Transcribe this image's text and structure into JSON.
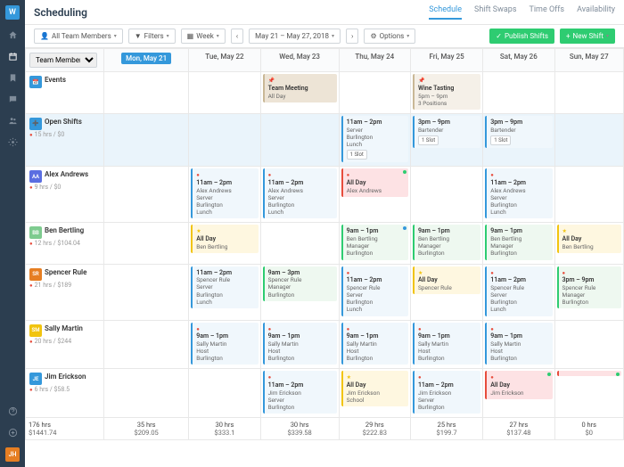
{
  "app": {
    "logo": "W",
    "avatar": "JH"
  },
  "header": {
    "title": "Scheduling",
    "tabs": [
      "Schedule",
      "Shift Swaps",
      "Time Offs",
      "Availability"
    ],
    "active": 0
  },
  "toolbar": {
    "team": "All Team Members",
    "filters": "Filters",
    "view": "Week",
    "range": "May 21 – May 27, 2018",
    "options": "Options",
    "publish": "Publish Shifts",
    "new": "New Shift",
    "members_label": "Team Members"
  },
  "days": [
    "Mon, May 21",
    "Tue, May 22",
    "Wed, May 23",
    "Thu, May 24",
    "Fri, May 25",
    "Sat, May 26",
    "Sun, May 27"
  ],
  "rows": {
    "events": {
      "label": "Events",
      "icon": "📅",
      "cells": [
        [],
        [],
        [
          {
            "cls": "beige pin",
            "t": "Team Meeting",
            "d": [
              "All Day"
            ]
          }
        ],
        [],
        [
          {
            "cls": "bage pin",
            "t": "Wine Tasting",
            "d": [
              "5pm – 9pm",
              "3 Positions"
            ]
          }
        ],
        [],
        []
      ]
    },
    "open": {
      "label": "Open Shifts",
      "sub": "15 hrs / $0",
      "icon": "➕",
      "cells": [
        [],
        [],
        [],
        [
          {
            "cls": "lblue",
            "t": "11am – 2pm",
            "d": [
              "Server",
              "Burlington",
              "Lunch"
            ],
            "tag": "1 Slot"
          }
        ],
        [
          {
            "cls": "lblue",
            "t": "3pm – 9pm",
            "d": [
              "Bartender"
            ],
            "tag": "1 Slot"
          }
        ],
        [
          {
            "cls": "lblue",
            "t": "3pm – 9pm",
            "d": [
              "Bartender"
            ],
            "tag": "1 Slot"
          }
        ],
        []
      ]
    },
    "alex": {
      "label": "Alex Andrews",
      "sub": "9 hrs / $0",
      "avcol": "#5b6ee1",
      "ini": "AA",
      "cells": [
        [],
        [
          {
            "cls": "lblue warn",
            "t": "11am – 2pm",
            "d": [
              "Alex Andrews",
              "Server",
              "Burlington",
              "Lunch"
            ]
          }
        ],
        [
          {
            "cls": "lblue warn",
            "t": "11am – 2pm",
            "d": [
              "Alex Andrews",
              "Server",
              "Burlington",
              "Lunch"
            ]
          }
        ],
        [
          {
            "cls": "pink warn",
            "t": "All Day",
            "d": [
              "Alex Andrews"
            ],
            "dot": "g"
          }
        ],
        [],
        [
          {
            "cls": "lblue warn",
            "t": "11am – 2pm",
            "d": [
              "Alex Andrews",
              "Server",
              "Burlington",
              "Lunch"
            ]
          }
        ],
        []
      ]
    },
    "ben": {
      "label": "Ben Bertling",
      "sub": "12 hrs / $104.04",
      "avcol": "#7ecb8f",
      "ini": "BB",
      "cells": [
        [],
        [
          {
            "cls": "yel star",
            "t": "All Day",
            "d": [
              "Ben Bertling"
            ]
          }
        ],
        [],
        [
          {
            "cls": "grn",
            "t": "9am – 1pm",
            "d": [
              "Ben Bertling",
              "Manager",
              "Burlington"
            ],
            "dot": "b"
          }
        ],
        [
          {
            "cls": "grn",
            "t": "9am – 1pm",
            "d": [
              "Ben Bertling",
              "Manager",
              "Burlington"
            ]
          }
        ],
        [
          {
            "cls": "grn",
            "t": "9am – 1pm",
            "d": [
              "Ben Bertling",
              "Manager",
              "Burlington"
            ]
          }
        ],
        [
          {
            "cls": "yel star",
            "t": "All Day",
            "d": [
              "Ben Bertling"
            ]
          }
        ]
      ]
    },
    "spencer": {
      "label": "Spencer Rule",
      "sub": "21 hrs / $189",
      "avcol": "#e67e22",
      "ini": "SR",
      "cells": [
        [],
        [
          {
            "cls": "lblue",
            "t": "11am – 2pm",
            "d": [
              "Spencer Rule",
              "Server",
              "Burlington",
              "Lunch"
            ]
          }
        ],
        [
          {
            "cls": "grn",
            "t": "9am – 3pm",
            "d": [
              "Spencer Rule",
              "Manager",
              "Burlington"
            ]
          }
        ],
        [
          {
            "cls": "lblue warn",
            "t": "11am – 2pm",
            "d": [
              "Spencer Rule",
              "Server",
              "Burlington",
              "Lunch"
            ]
          }
        ],
        [
          {
            "cls": "yel star",
            "t": "All Day",
            "d": [
              "Spencer Rule"
            ]
          }
        ],
        [
          {
            "cls": "lblue warn",
            "t": "11am – 2pm",
            "d": [
              "Spencer Rule",
              "Server",
              "Burlington",
              "Lunch"
            ]
          }
        ],
        [
          {
            "cls": "grn warn",
            "t": "3pm – 9pm",
            "d": [
              "Spencer Rule",
              "Manager",
              "Burlington"
            ]
          }
        ]
      ]
    },
    "sally": {
      "label": "Sally Martin",
      "sub": "20 hrs / $244",
      "avcol": "#f1c40f",
      "ini": "SM",
      "cells": [
        [],
        [
          {
            "cls": "lblue warn",
            "t": "9am – 1pm",
            "d": [
              "Sally Martin",
              "Host",
              "Burlington"
            ]
          }
        ],
        [
          {
            "cls": "lblue warn",
            "t": "9am – 1pm",
            "d": [
              "Sally Martin",
              "Host",
              "Burlington"
            ]
          }
        ],
        [
          {
            "cls": "lblue warn",
            "t": "9am – 1pm",
            "d": [
              "Sally Martin",
              "Host",
              "Burlington"
            ]
          }
        ],
        [
          {
            "cls": "lblue warn",
            "t": "9am – 1pm",
            "d": [
              "Sally Martin",
              "Host",
              "Burlington"
            ]
          }
        ],
        [
          {
            "cls": "lblue warn",
            "t": "9am – 1pm",
            "d": [
              "Sally Martin",
              "Host",
              "Burlington"
            ]
          }
        ],
        []
      ]
    },
    "jim": {
      "label": "Jim Erickson",
      "sub": "6 hrs / $58.5",
      "avcol": "#3498db",
      "ini": "JE",
      "cells": [
        [],
        [],
        [
          {
            "cls": "lblue warn",
            "t": "11am – 2pm",
            "d": [
              "Jim Erickson",
              "Server",
              "Burlington"
            ]
          }
        ],
        [
          {
            "cls": "yel star",
            "t": "All Day",
            "d": [
              "Jim Erickson",
              "School"
            ]
          }
        ],
        [
          {
            "cls": "lblue warn",
            "t": "11am – 2pm",
            "d": [
              "Jim Erickson",
              "Server",
              "Burlington"
            ]
          }
        ],
        [
          {
            "cls": "pink warn",
            "t": "All Day",
            "d": [
              "Jim Erickson"
            ],
            "dot": "g"
          }
        ],
        [
          {
            "cls": "pink",
            "dot": "g"
          }
        ]
      ]
    }
  },
  "totals": {
    "first": {
      "l1": "176 hrs",
      "l2": "$1441.74"
    },
    "cols": [
      {
        "l1": "35 hrs",
        "l2": "$209.05"
      },
      {
        "l1": "30 hrs",
        "l2": "$333.1"
      },
      {
        "l1": "30 hrs",
        "l2": "$339.58"
      },
      {
        "l1": "29 hrs",
        "l2": "$222.83"
      },
      {
        "l1": "25 hrs",
        "l2": "$199.7"
      },
      {
        "l1": "27 hrs",
        "l2": "$137.48"
      },
      {
        "l1": "0 hrs",
        "l2": "$0"
      }
    ]
  }
}
